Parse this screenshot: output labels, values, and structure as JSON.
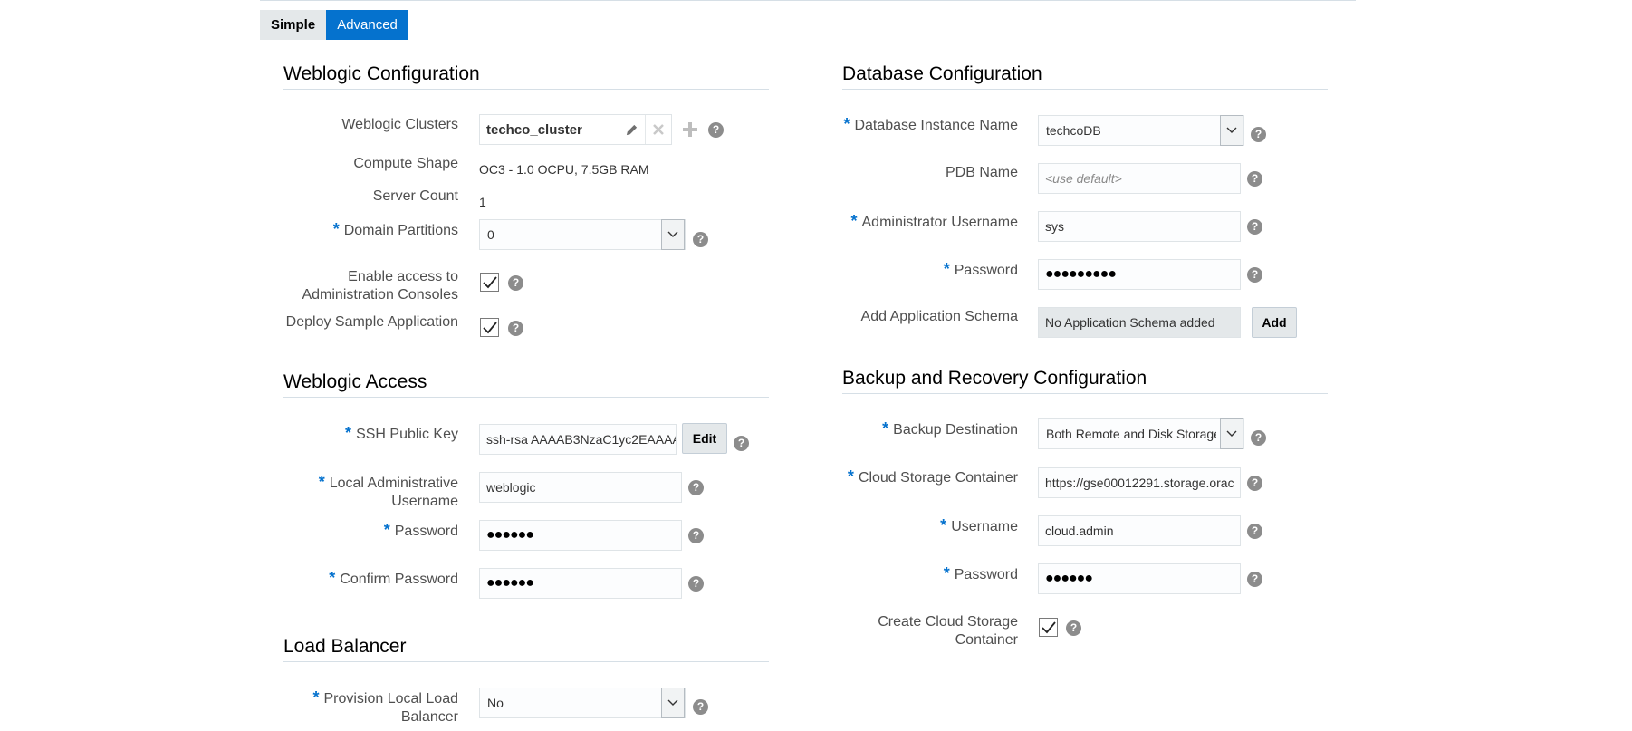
{
  "tabs": {
    "simple": "Simple",
    "advanced": "Advanced"
  },
  "weblogic_config": {
    "title": "Weblogic Configuration",
    "clusters_label": "Weblogic Clusters",
    "cluster_name": "techco_cluster",
    "compute_shape_label": "Compute Shape",
    "compute_shape_value": "OC3 - 1.0 OCPU, 7.5GB RAM",
    "server_count_label": "Server Count",
    "server_count_value": "1",
    "domain_partitions_label": "Domain Partitions",
    "domain_partitions_value": "0",
    "enable_access_label_1": "Enable access to",
    "enable_access_label_2": "Administration Consoles",
    "enable_access_checked": true,
    "deploy_sample_label": "Deploy Sample Application",
    "deploy_sample_checked": true
  },
  "weblogic_access": {
    "title": "Weblogic Access",
    "ssh_label": "SSH Public Key",
    "ssh_value": "ssh-rsa AAAAB3NzaC1yc2EAAAA",
    "edit_label": "Edit",
    "local_admin_label_1": "Local Administrative",
    "local_admin_label_2": "Username",
    "local_admin_value": "weblogic",
    "password_label": "Password",
    "password_value": "●●●●●●",
    "confirm_password_label": "Confirm Password",
    "confirm_password_value": "●●●●●●"
  },
  "load_balancer": {
    "title": "Load Balancer",
    "provision_label_1": "Provision Local Load",
    "provision_label_2": "Balancer",
    "provision_value": "No"
  },
  "database_config": {
    "title": "Database Configuration",
    "instance_label": "Database Instance Name",
    "instance_value": "techcoDB",
    "pdb_label": "PDB Name",
    "pdb_placeholder": "<use default>",
    "admin_user_label": "Administrator Username",
    "admin_user_value": "sys",
    "password_label": "Password",
    "password_value": "●●●●●●●●●",
    "app_schema_label": "Add Application Schema",
    "app_schema_value": "No Application Schema added",
    "add_label": "Add"
  },
  "backup_config": {
    "title": "Backup and Recovery Configuration",
    "destination_label": "Backup Destination",
    "destination_value": "Both Remote and Disk Storage",
    "container_label": "Cloud Storage Container",
    "container_value": "https://gse00012291.storage.orac",
    "username_label": "Username",
    "username_value": "cloud.admin",
    "password_label": "Password",
    "password_value": "●●●●●●",
    "create_container_label_1": "Create Cloud Storage",
    "create_container_label_2": "Container",
    "create_container_checked": true
  },
  "colors": {
    "accent": "#0572ce",
    "required": "#0572ce",
    "help": "#8c8c8c"
  },
  "help_glyph": "?"
}
